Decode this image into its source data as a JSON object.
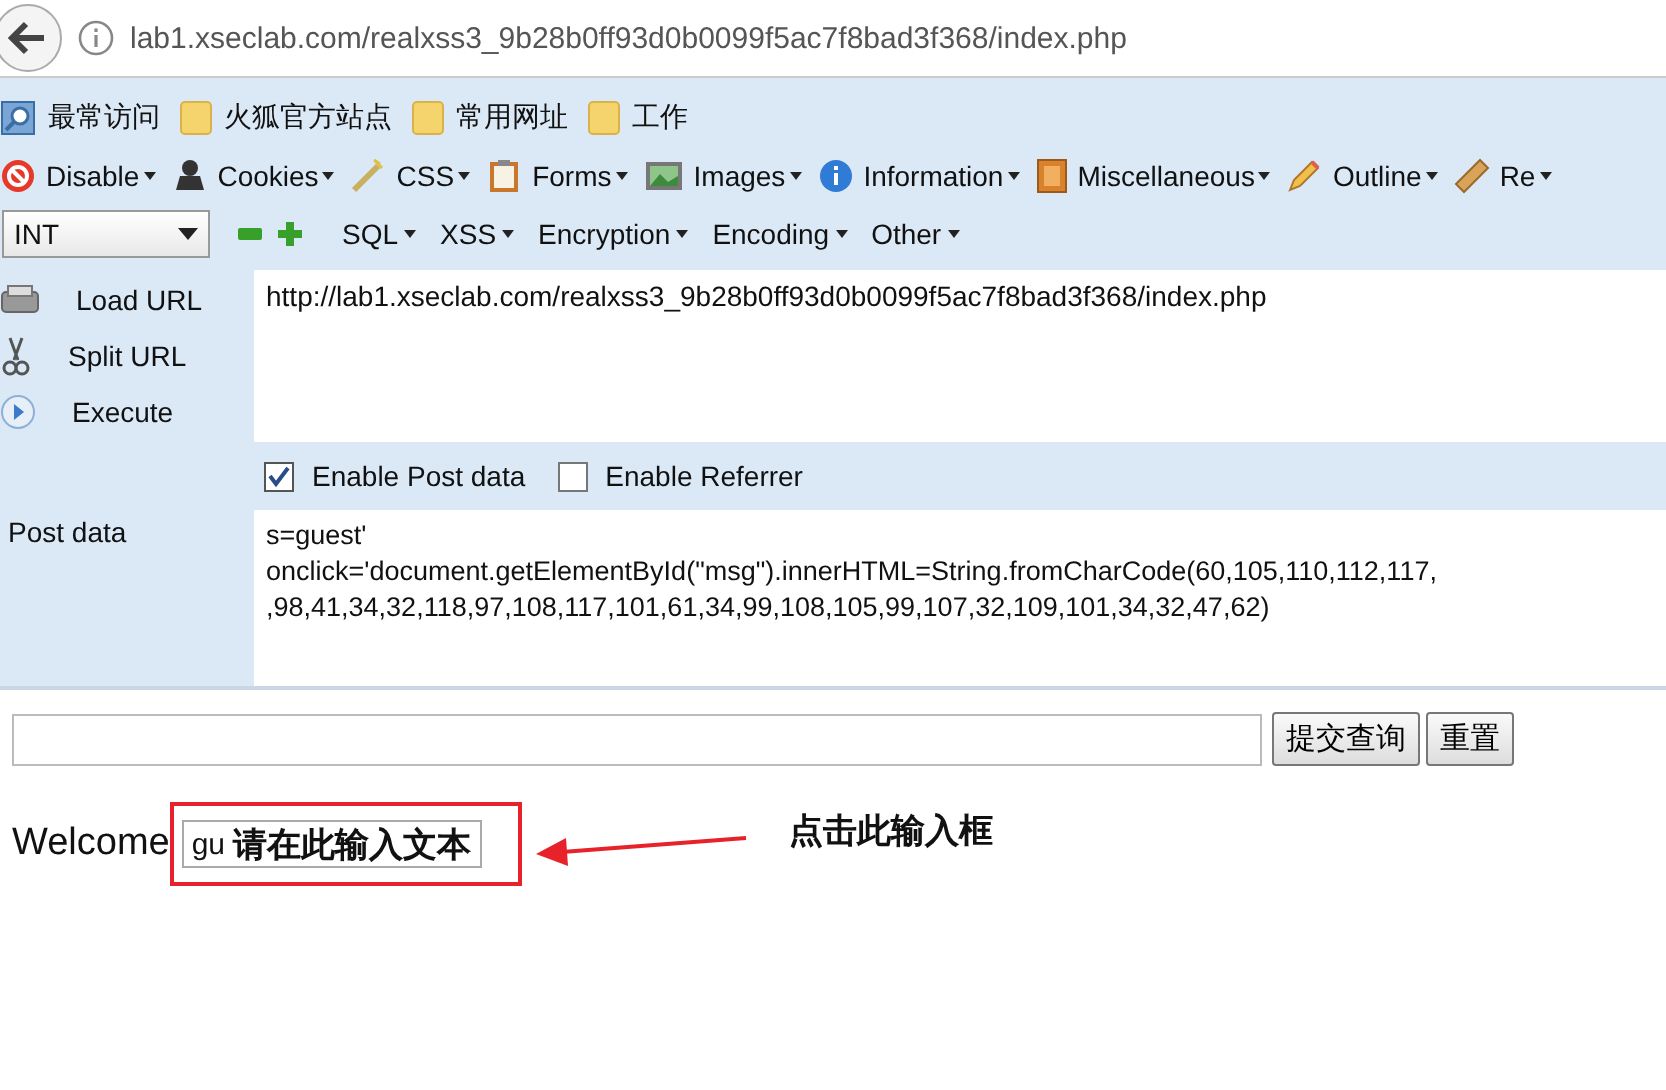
{
  "address_bar": {
    "url": "lab1.xseclab.com/realxss3_9b28b0ff93d0b0099f5ac7f8bad3f368/index.php"
  },
  "bookmarks": [
    {
      "label": "最常访问",
      "kind": "history"
    },
    {
      "label": "火狐官方站点",
      "kind": "folder"
    },
    {
      "label": "常用网址",
      "kind": "folder"
    },
    {
      "label": "工作",
      "kind": "folder"
    }
  ],
  "dev_toolbar": [
    {
      "label": "Disable",
      "kind": "disable"
    },
    {
      "label": "Cookies",
      "kind": "cookies"
    },
    {
      "label": "CSS",
      "kind": "css"
    },
    {
      "label": "Forms",
      "kind": "forms"
    },
    {
      "label": "Images",
      "kind": "images"
    },
    {
      "label": "Information",
      "kind": "info"
    },
    {
      "label": "Miscellaneous",
      "kind": "misc"
    },
    {
      "label": "Outline",
      "kind": "outline"
    },
    {
      "label": "Re",
      "kind": "ruler"
    }
  ],
  "hackbar": {
    "select": "INT",
    "menus": [
      "SQL",
      "XSS",
      "Encryption",
      "Encoding",
      "Other"
    ],
    "actions": [
      {
        "label": "Load URL",
        "kind": "load"
      },
      {
        "label": "Split URL",
        "kind": "split"
      },
      {
        "label": "Execute",
        "kind": "execute"
      }
    ],
    "url_field": "http://lab1.xseclab.com/realxss3_9b28b0ff93d0b0099f5ac7f8bad3f368/index.php",
    "options": [
      {
        "label": "Enable Post data",
        "checked": true
      },
      {
        "label": "Enable Referrer",
        "checked": false
      }
    ],
    "post_label": "Post data",
    "post_lines": [
      "s=guest'",
      "onclick='document.getElementById(\"msg\").innerHTML=String.fromCharCode(60,105,110,112,117,",
      ",98,41,34,32,118,97,108,117,101,61,34,99,108,105,99,107,32,109,101,34,32,47,62)"
    ]
  },
  "page": {
    "buttons": [
      "提交查询",
      "重置"
    ],
    "welcome": "Welcome",
    "input_value": "gu",
    "injected_text": "请在此输入文本",
    "annotation": "点击此输入框"
  }
}
